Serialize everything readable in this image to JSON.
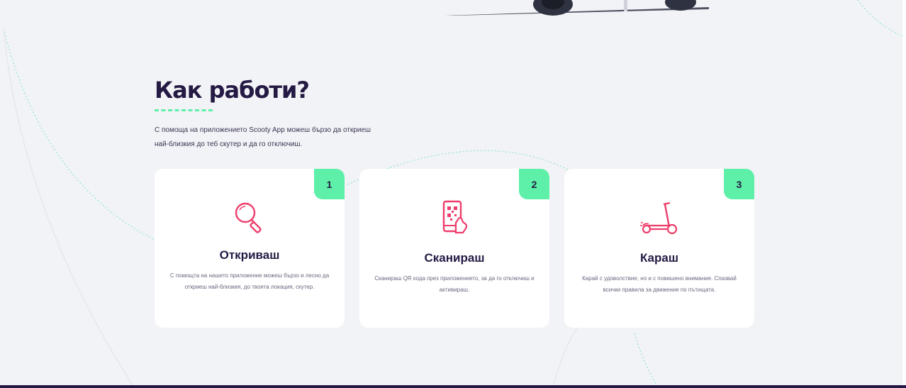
{
  "section": {
    "title": "Как работи?",
    "intro": "С помоща на приложението Scooty App можеш бързо да откриеш най-близкия до теб скутер и да го отключиш."
  },
  "steps": [
    {
      "number": "1",
      "icon": "magnifier-icon",
      "title": "Откриваш",
      "text": "С помощта на нашето приложение можеш бързо и лесно да откриеш най-близкия, до твоята локация, скутер."
    },
    {
      "number": "2",
      "icon": "phone-qr-icon",
      "title": "Сканираш",
      "text": "Сканираш QR кода през приложението, за да го отключиш и активираш."
    },
    {
      "number": "3",
      "icon": "scooter-icon",
      "title": "Караш",
      "text": "Карай с удоволствие, но и с повишено внимание. Спазвай всички правила за движение по пътищата."
    }
  ],
  "colors": {
    "accent_green": "#5ef0a9",
    "icon_pink": "#ee3d6b",
    "title_navy": "#241a44",
    "background": "#f2f3f6"
  }
}
